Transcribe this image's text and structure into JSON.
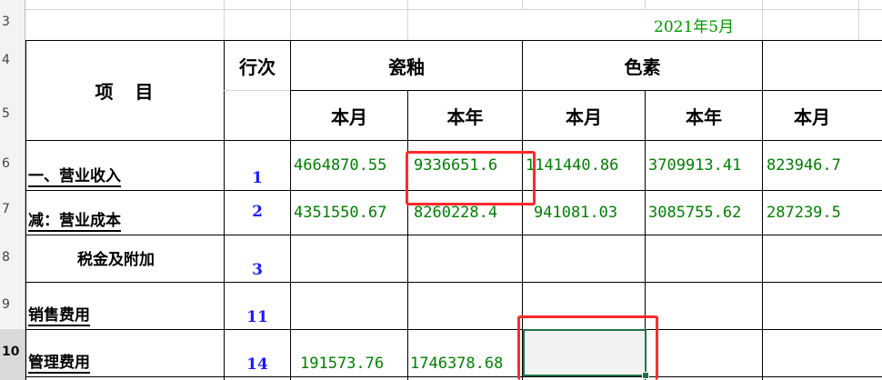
{
  "sheet": {
    "row_numbers": [
      "3",
      "4",
      "5",
      "6",
      "7",
      "8",
      "9",
      "10"
    ],
    "period": "2021年5月",
    "headers": {
      "item": "项　目",
      "row_index": "行次",
      "group1": "瓷釉",
      "group2": "色素",
      "month": "本月",
      "year": "本年"
    },
    "rows": [
      {
        "item": "一、营业收入",
        "row_index": "1",
        "c1_month": "4664870.55",
        "c1_year": "9336651.6",
        "c2_month": "1141440.86",
        "c2_year": "3709913.41",
        "c3_month": "823946.7"
      },
      {
        "item": "减：营业成本",
        "row_index": "2",
        "c1_month": "4351550.67",
        "c1_year": "8260228.4",
        "c2_month": "941081.03",
        "c2_year": "3085755.62",
        "c3_month": "287239.5"
      },
      {
        "item": "税金及附加",
        "row_index": "3",
        "c1_month": "",
        "c1_year": "",
        "c2_month": "",
        "c2_year": "",
        "c3_month": ""
      },
      {
        "item": "销售费用",
        "row_index": "11",
        "c1_month": "",
        "c1_year": "",
        "c2_month": "",
        "c2_year": "",
        "c3_month": ""
      },
      {
        "item": "管理费用",
        "row_index": "14",
        "c1_month": "191573.76",
        "c1_year": "1746378.68",
        "c2_month": "",
        "c2_year": "",
        "c3_month": ""
      }
    ]
  },
  "colors": {
    "value_text": "#008000",
    "row_index_text": "#1a1aff",
    "highlight_box": "#ff2a2a",
    "selection": "#217346"
  }
}
